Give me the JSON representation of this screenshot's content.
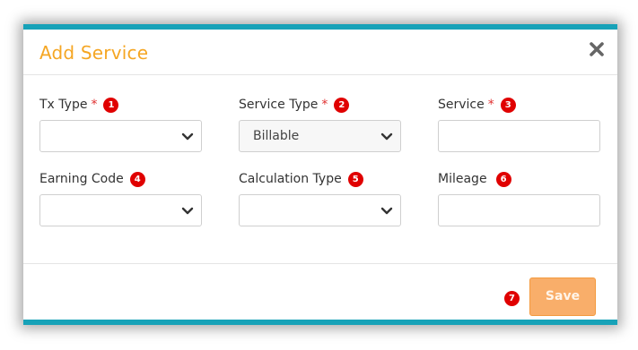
{
  "colors": {
    "accent_bar": "#17a2b8",
    "title": "#f5a623",
    "badge": "#e00000",
    "save_bg": "#f9ae6a"
  },
  "modal": {
    "title": "Add Service",
    "close_icon": "close-icon",
    "required_marker": "*",
    "fields": [
      {
        "label": "Tx Type",
        "required": true,
        "badge": "1",
        "type": "select",
        "value": ""
      },
      {
        "label": "Service Type",
        "required": true,
        "badge": "2",
        "type": "select",
        "value": "Billable"
      },
      {
        "label": "Service",
        "required": true,
        "badge": "3",
        "type": "input",
        "value": ""
      },
      {
        "label": "Earning Code",
        "required": false,
        "badge": "4",
        "type": "select",
        "value": ""
      },
      {
        "label": "Calculation Type",
        "required": false,
        "badge": "5",
        "type": "select",
        "value": ""
      },
      {
        "label": "Mileage",
        "required": false,
        "badge": "6",
        "type": "input",
        "value": ""
      }
    ],
    "save_label": "Save",
    "save_badge": "7"
  }
}
